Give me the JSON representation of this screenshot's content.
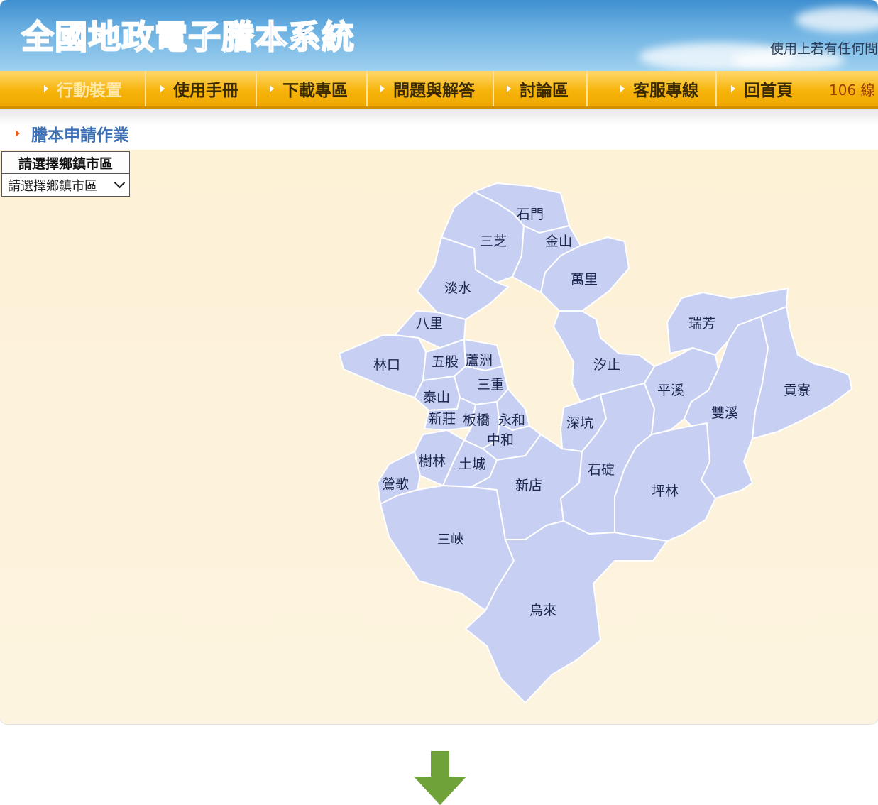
{
  "header": {
    "logo": {
      "part1": "全國",
      "part2": "地政",
      "part3": "電子謄本系統"
    },
    "notice": "使用上若有任何問"
  },
  "nav": {
    "items": [
      {
        "label": "行動裝置",
        "disabled": true
      },
      {
        "label": "使用手冊"
      },
      {
        "label": "下載專區"
      },
      {
        "label": "問題與解答"
      },
      {
        "label": "討論區"
      },
      {
        "label": "客服專線"
      },
      {
        "label": "回首頁"
      }
    ],
    "extra": "106 線"
  },
  "page": {
    "title": "謄本申請作業"
  },
  "selector": {
    "label": "請選擇鄉鎮市區",
    "value": "請選擇鄉鎮市區"
  },
  "map": {
    "districts": {
      "shimen": "石門",
      "sanzhi": "三芝",
      "jinshan": "金山",
      "wanli": "萬里",
      "tamsui": "淡水",
      "bali": "八里",
      "linkou": "林口",
      "wugu": "五股",
      "luzhou": "蘆洲",
      "sanchong": "三重",
      "taishan": "泰山",
      "xinzhuang": "新莊",
      "banqiao": "板橋",
      "yonghe": "永和",
      "zhonghe": "中和",
      "shulin": "樹林",
      "tucheng": "土城",
      "yingge": "鶯歌",
      "sanxia": "三峽",
      "xindian": "新店",
      "wulai": "烏來",
      "xizhi": "汐止",
      "shenkeng": "深坑",
      "shiding": "石碇",
      "pinglin": "坪林",
      "pingxi": "平溪",
      "ruifang": "瑞芳",
      "shuangxi": "雙溪",
      "gongliao": "貢寮"
    }
  },
  "colors": {
    "district_fill": "#c7d0f3",
    "nav_bg": "#f7b40c",
    "arrow": "#6fa33a"
  }
}
